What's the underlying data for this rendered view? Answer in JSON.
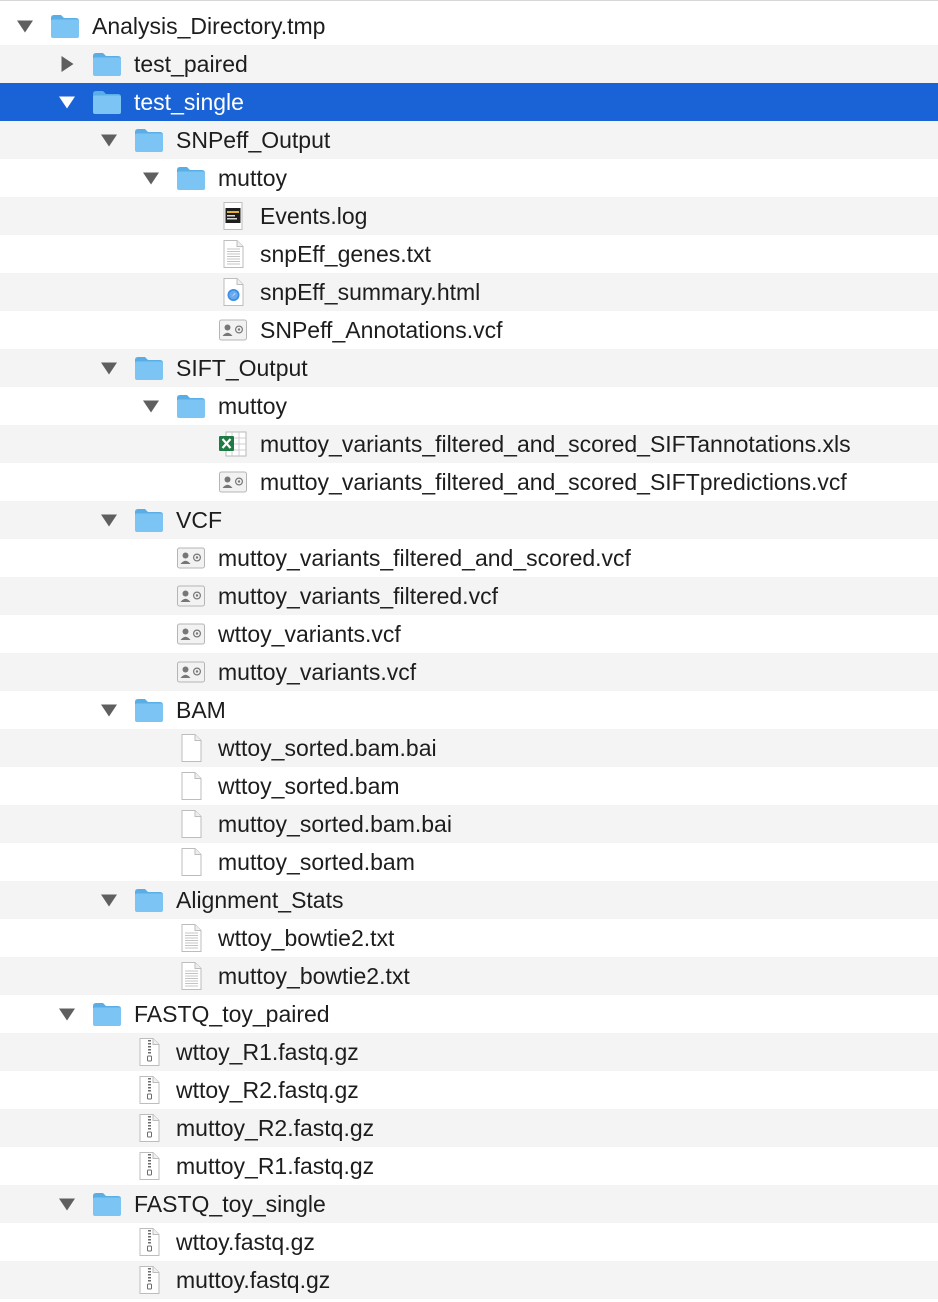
{
  "colors": {
    "selection": "#1a63d6",
    "folder": "#7cc4f4",
    "folder_dark": "#5aaee6",
    "stripe": "#f4f4f4",
    "disclosure": "#5f5f5f"
  },
  "rows": [
    {
      "depth": 0,
      "disclosure": "expanded",
      "icon": "folder-icon",
      "label": "Analysis_Directory.tmp"
    },
    {
      "depth": 1,
      "disclosure": "collapsed",
      "icon": "folder-icon",
      "label": "test_paired"
    },
    {
      "depth": 1,
      "disclosure": "expanded",
      "icon": "folder-icon",
      "label": "test_single",
      "selected": true
    },
    {
      "depth": 2,
      "disclosure": "expanded",
      "icon": "folder-icon",
      "label": "SNPeff_Output"
    },
    {
      "depth": 3,
      "disclosure": "expanded",
      "icon": "folder-icon",
      "label": "muttoy"
    },
    {
      "depth": 4,
      "icon": "log-file-icon",
      "label": "Events.log"
    },
    {
      "depth": 4,
      "icon": "text-file-icon",
      "label": "snpEff_genes.txt"
    },
    {
      "depth": 4,
      "icon": "html-file-icon",
      "label": "snpEff_summary.html"
    },
    {
      "depth": 4,
      "icon": "vcard-file-icon",
      "label": "SNPeff_Annotations.vcf"
    },
    {
      "depth": 2,
      "disclosure": "expanded",
      "icon": "folder-icon",
      "label": "SIFT_Output"
    },
    {
      "depth": 3,
      "disclosure": "expanded",
      "icon": "folder-icon",
      "label": "muttoy"
    },
    {
      "depth": 4,
      "icon": "excel-file-icon",
      "label": "muttoy_variants_filtered_and_scored_SIFTannotations.xls"
    },
    {
      "depth": 4,
      "icon": "vcard-file-icon",
      "label": "muttoy_variants_filtered_and_scored_SIFTpredictions.vcf"
    },
    {
      "depth": 2,
      "disclosure": "expanded",
      "icon": "folder-icon",
      "label": "VCF"
    },
    {
      "depth": 3,
      "icon": "vcard-file-icon",
      "label": "muttoy_variants_filtered_and_scored.vcf"
    },
    {
      "depth": 3,
      "icon": "vcard-file-icon",
      "label": "muttoy_variants_filtered.vcf"
    },
    {
      "depth": 3,
      "icon": "vcard-file-icon",
      "label": "wttoy_variants.vcf"
    },
    {
      "depth": 3,
      "icon": "vcard-file-icon",
      "label": "muttoy_variants.vcf"
    },
    {
      "depth": 2,
      "disclosure": "expanded",
      "icon": "folder-icon",
      "label": "BAM"
    },
    {
      "depth": 3,
      "icon": "blank-file-icon",
      "label": "wttoy_sorted.bam.bai"
    },
    {
      "depth": 3,
      "icon": "blank-file-icon",
      "label": "wttoy_sorted.bam"
    },
    {
      "depth": 3,
      "icon": "blank-file-icon",
      "label": "muttoy_sorted.bam.bai"
    },
    {
      "depth": 3,
      "icon": "blank-file-icon",
      "label": "muttoy_sorted.bam"
    },
    {
      "depth": 2,
      "disclosure": "expanded",
      "icon": "folder-icon",
      "label": "Alignment_Stats"
    },
    {
      "depth": 3,
      "icon": "text-file-icon",
      "label": "wttoy_bowtie2.txt"
    },
    {
      "depth": 3,
      "icon": "text-file-icon",
      "label": "muttoy_bowtie2.txt"
    },
    {
      "depth": 1,
      "disclosure": "expanded",
      "icon": "folder-icon",
      "label": "FASTQ_toy_paired"
    },
    {
      "depth": 2,
      "icon": "zip-file-icon",
      "label": "wttoy_R1.fastq.gz"
    },
    {
      "depth": 2,
      "icon": "zip-file-icon",
      "label": "wttoy_R2.fastq.gz"
    },
    {
      "depth": 2,
      "icon": "zip-file-icon",
      "label": "muttoy_R2.fastq.gz"
    },
    {
      "depth": 2,
      "icon": "zip-file-icon",
      "label": "muttoy_R1.fastq.gz"
    },
    {
      "depth": 1,
      "disclosure": "expanded",
      "icon": "folder-icon",
      "label": "FASTQ_toy_single"
    },
    {
      "depth": 2,
      "icon": "zip-file-icon",
      "label": "wttoy.fastq.gz"
    },
    {
      "depth": 2,
      "icon": "zip-file-icon",
      "label": "muttoy.fastq.gz"
    }
  ]
}
